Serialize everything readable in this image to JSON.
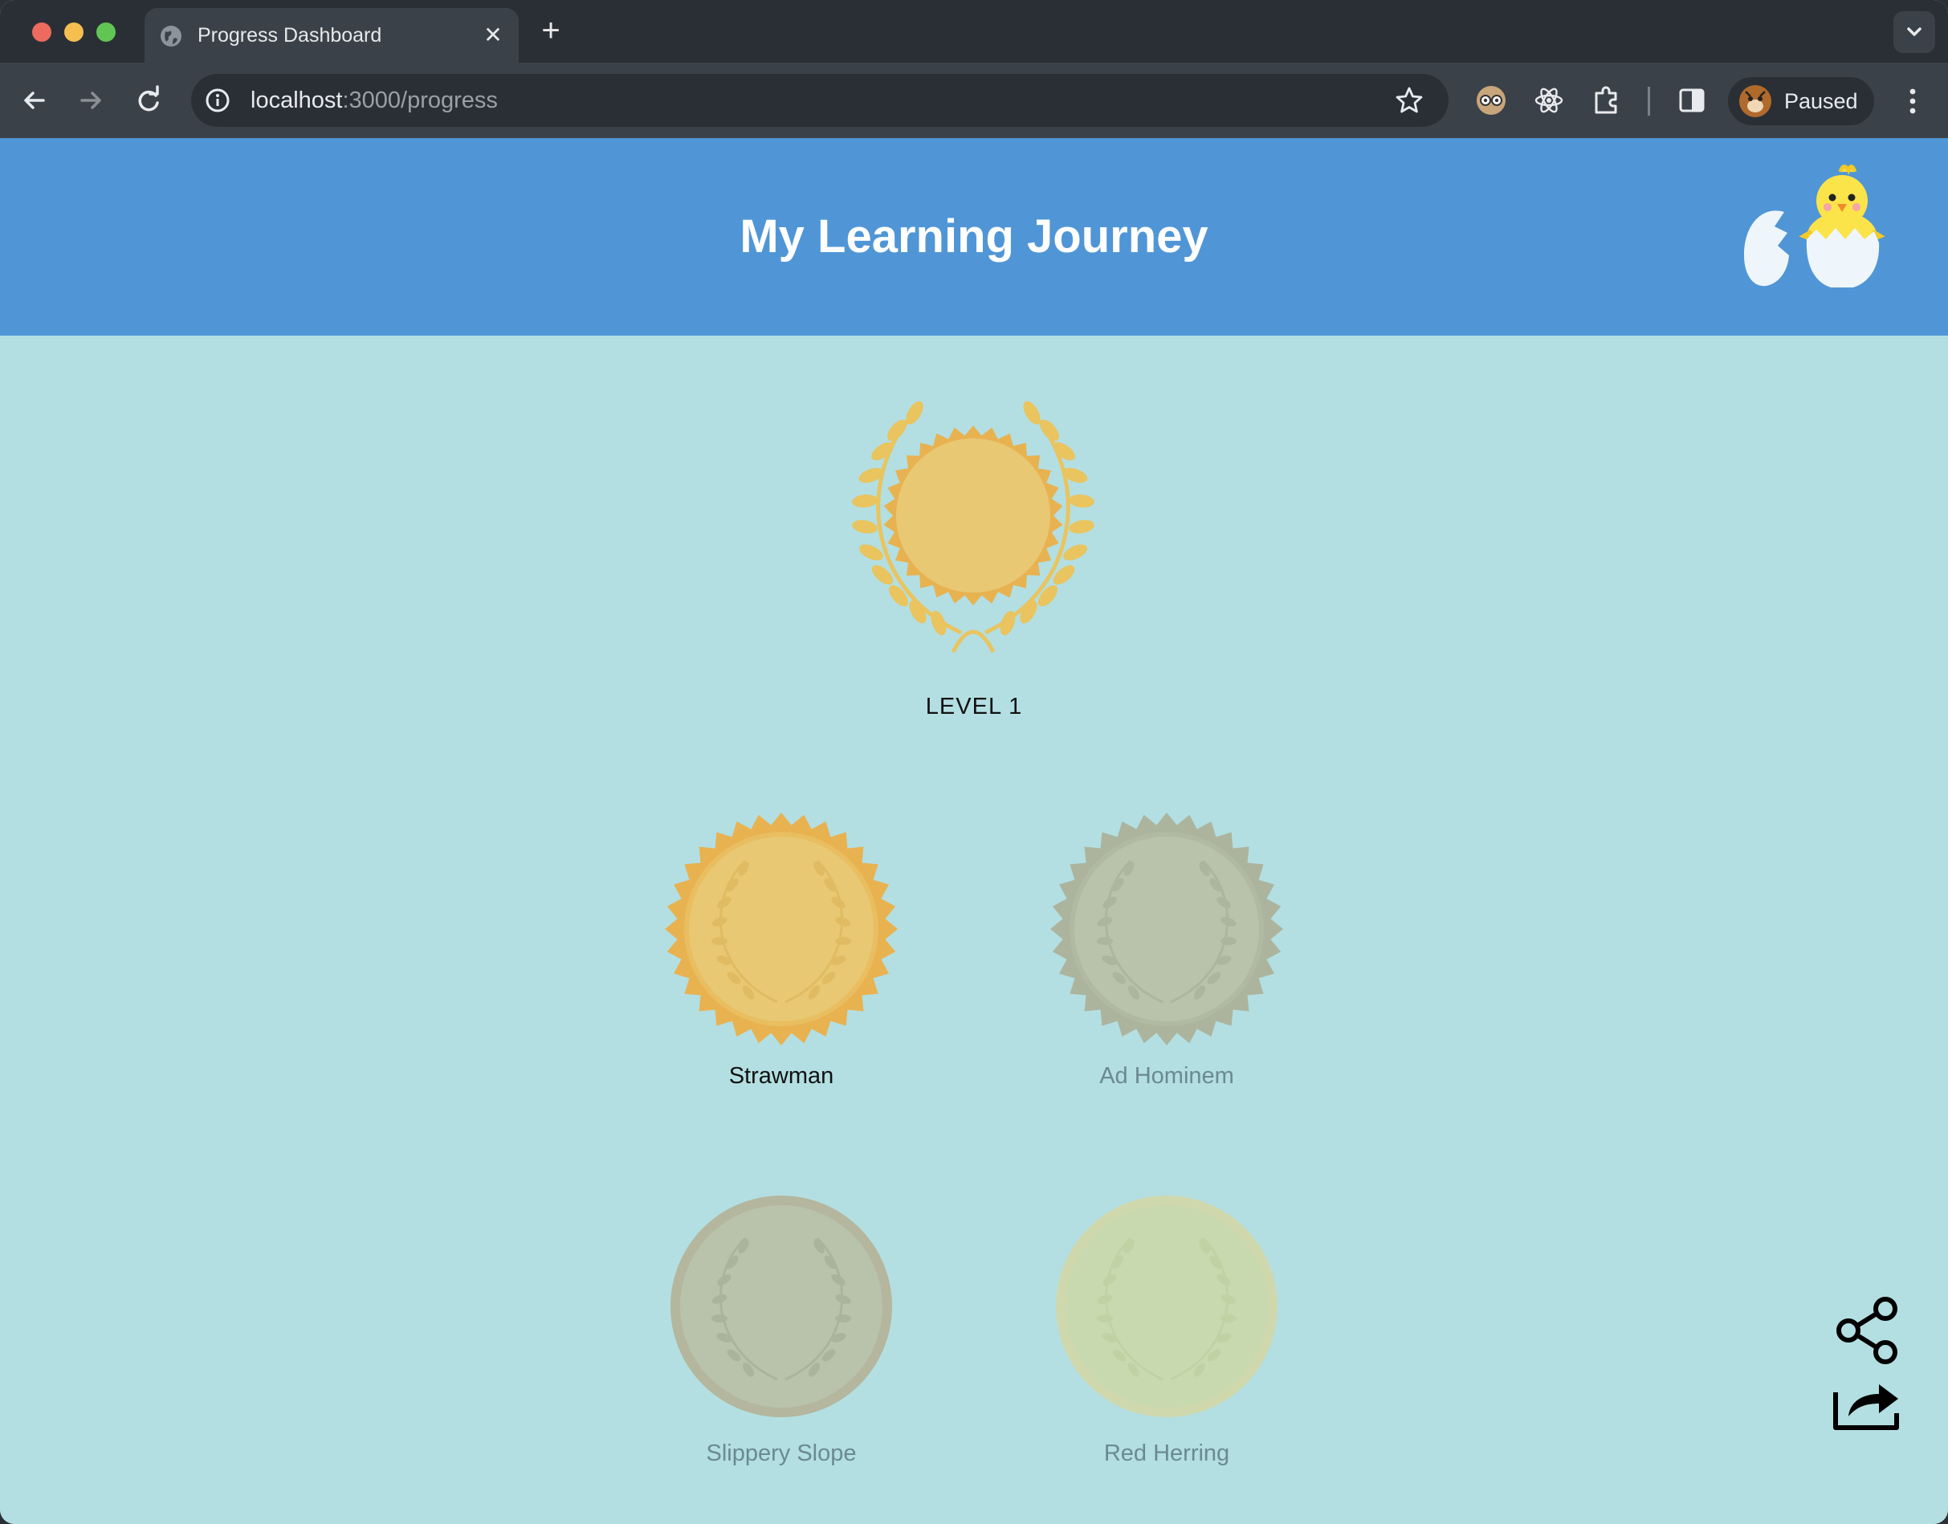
{
  "browser": {
    "tab_title": "Progress Dashboard",
    "new_tab_symbol": "+",
    "tab_close_symbol": "✕",
    "url_host": "localhost",
    "url_path": ":3000/progress",
    "profile_label": "Paused",
    "icons": [
      "globe-icon",
      "back-icon",
      "forward-icon",
      "reload-icon",
      "site-info-icon",
      "bookmark-star-icon",
      "extension-glasses-icon",
      "react-devtools-icon",
      "extensions-puzzle-icon",
      "side-panel-icon",
      "kebab-menu-icon"
    ]
  },
  "header": {
    "title": "My Learning Journey",
    "mascot_icon": "hatching-chick-icon"
  },
  "level": {
    "label": "LEVEL 1",
    "status": "earned"
  },
  "badges": [
    {
      "label": "Strawman",
      "status": "earned",
      "color": "#e5c573"
    },
    {
      "label": "Ad Hominem",
      "status": "locked",
      "color": "#b9c2ab"
    },
    {
      "label": "Slippery Slope",
      "status": "locked",
      "color": "#b8c2ab"
    },
    {
      "label": "Red Herring",
      "status": "locked",
      "color": "#c8d9b0"
    }
  ],
  "actions": {
    "share_icon": "share-icon",
    "export_icon": "export-share-icon"
  },
  "colors": {
    "header_bg": "#5096d6",
    "page_bg": "#b3dfe2",
    "gold": "#e5c573",
    "gold_dark": "#e8b251"
  }
}
